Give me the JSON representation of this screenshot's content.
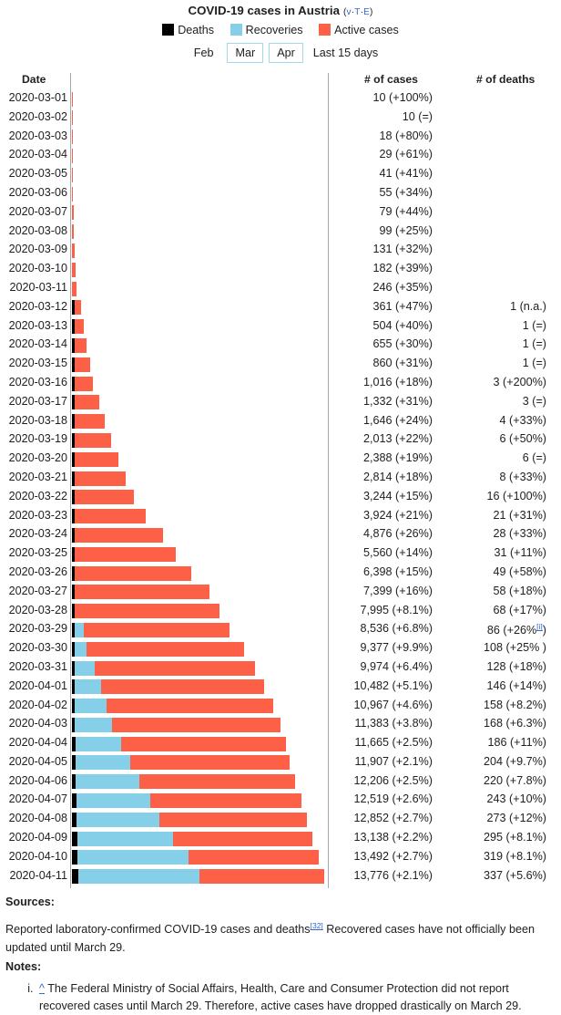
{
  "header": {
    "title": "COVID-19 cases in Austria",
    "vte": {
      "open": "(",
      "v": "v",
      "sep1": "·",
      "t": "T",
      "sep2": "·",
      "e": "E",
      "close": ")"
    },
    "legend": [
      {
        "label": "Deaths",
        "color": "#000000",
        "icon": "legend-swatch"
      },
      {
        "label": "Recoveries",
        "color": "#85cfe8",
        "icon": "legend-swatch"
      },
      {
        "label": "Active cases",
        "color": "#fc6148",
        "icon": "legend-swatch"
      }
    ],
    "months": [
      {
        "label": "Feb",
        "boxed": false
      },
      {
        "label": "Mar",
        "boxed": true
      },
      {
        "label": "Apr",
        "boxed": true
      }
    ],
    "range_label": "Last 15 days"
  },
  "table": {
    "columns": {
      "date": "Date",
      "cases": "# of cases",
      "deaths": "# of deaths"
    }
  },
  "chart_data": {
    "type": "bar",
    "title": "COVID-19 cases in Austria",
    "orientation": "horizontal",
    "stacked": true,
    "xlabel": "",
    "ylabel": "Date",
    "xlim": [
      0,
      13776
    ],
    "grid": false,
    "legend_position": "top",
    "series": [
      {
        "name": "Deaths",
        "color": "#000000"
      },
      {
        "name": "Recoveries",
        "color": "#85cfe8"
      },
      {
        "name": "Active cases",
        "color": "#fc6148"
      }
    ],
    "categories": [
      "2020-03-01",
      "2020-03-02",
      "2020-03-03",
      "2020-03-04",
      "2020-03-05",
      "2020-03-06",
      "2020-03-07",
      "2020-03-08",
      "2020-03-09",
      "2020-03-10",
      "2020-03-11",
      "2020-03-12",
      "2020-03-13",
      "2020-03-14",
      "2020-03-15",
      "2020-03-16",
      "2020-03-17",
      "2020-03-18",
      "2020-03-19",
      "2020-03-20",
      "2020-03-21",
      "2020-03-22",
      "2020-03-23",
      "2020-03-24",
      "2020-03-25",
      "2020-03-26",
      "2020-03-27",
      "2020-03-28",
      "2020-03-29",
      "2020-03-30",
      "2020-03-31",
      "2020-04-01",
      "2020-04-02",
      "2020-04-03",
      "2020-04-04",
      "2020-04-05",
      "2020-04-06",
      "2020-04-07",
      "2020-04-08",
      "2020-04-09",
      "2020-04-10",
      "2020-04-11"
    ],
    "rows": [
      {
        "date": "2020-03-01",
        "cases": 10,
        "cases_label": "10 (+100%)",
        "deaths": 0,
        "deaths_label": "",
        "deaths_sup": "",
        "recoveries": 0
      },
      {
        "date": "2020-03-02",
        "cases": 10,
        "cases_label": "10 (=)",
        "deaths": 0,
        "deaths_label": "",
        "deaths_sup": "",
        "recoveries": 0
      },
      {
        "date": "2020-03-03",
        "cases": 18,
        "cases_label": "18 (+80%)",
        "deaths": 0,
        "deaths_label": "",
        "deaths_sup": "",
        "recoveries": 0
      },
      {
        "date": "2020-03-04",
        "cases": 29,
        "cases_label": "29 (+61%)",
        "deaths": 0,
        "deaths_label": "",
        "deaths_sup": "",
        "recoveries": 0
      },
      {
        "date": "2020-03-05",
        "cases": 41,
        "cases_label": "41 (+41%)",
        "deaths": 0,
        "deaths_label": "",
        "deaths_sup": "",
        "recoveries": 0
      },
      {
        "date": "2020-03-06",
        "cases": 55,
        "cases_label": "55 (+34%)",
        "deaths": 0,
        "deaths_label": "",
        "deaths_sup": "",
        "recoveries": 0
      },
      {
        "date": "2020-03-07",
        "cases": 79,
        "cases_label": "79 (+44%)",
        "deaths": 0,
        "deaths_label": "",
        "deaths_sup": "",
        "recoveries": 0
      },
      {
        "date": "2020-03-08",
        "cases": 99,
        "cases_label": "99 (+25%)",
        "deaths": 0,
        "deaths_label": "",
        "deaths_sup": "",
        "recoveries": 0
      },
      {
        "date": "2020-03-09",
        "cases": 131,
        "cases_label": "131 (+32%)",
        "deaths": 0,
        "deaths_label": "",
        "deaths_sup": "",
        "recoveries": 0
      },
      {
        "date": "2020-03-10",
        "cases": 182,
        "cases_label": "182 (+39%)",
        "deaths": 0,
        "deaths_label": "",
        "deaths_sup": "",
        "recoveries": 0
      },
      {
        "date": "2020-03-11",
        "cases": 246,
        "cases_label": "246 (+35%)",
        "deaths": 0,
        "deaths_label": "",
        "deaths_sup": "",
        "recoveries": 0
      },
      {
        "date": "2020-03-12",
        "cases": 361,
        "cases_label": "361 (+47%)",
        "deaths": 1,
        "deaths_label": "1 (n.a.)",
        "deaths_sup": "",
        "recoveries": 0
      },
      {
        "date": "2020-03-13",
        "cases": 504,
        "cases_label": "504 (+40%)",
        "deaths": 1,
        "deaths_label": "1 (=)",
        "deaths_sup": "",
        "recoveries": 0
      },
      {
        "date": "2020-03-14",
        "cases": 655,
        "cases_label": "655 (+30%)",
        "deaths": 1,
        "deaths_label": "1 (=)",
        "deaths_sup": "",
        "recoveries": 0
      },
      {
        "date": "2020-03-15",
        "cases": 860,
        "cases_label": "860 (+31%)",
        "deaths": 1,
        "deaths_label": "1 (=)",
        "deaths_sup": "",
        "recoveries": 0
      },
      {
        "date": "2020-03-16",
        "cases": 1016,
        "cases_label": "1,016 (+18%)",
        "deaths": 3,
        "deaths_label": "3 (+200%)",
        "deaths_sup": "",
        "recoveries": 0
      },
      {
        "date": "2020-03-17",
        "cases": 1332,
        "cases_label": "1,332 (+31%)",
        "deaths": 3,
        "deaths_label": "3 (=)",
        "deaths_sup": "",
        "recoveries": 0
      },
      {
        "date": "2020-03-18",
        "cases": 1646,
        "cases_label": "1,646 (+24%)",
        "deaths": 4,
        "deaths_label": "4 (+33%)",
        "deaths_sup": "",
        "recoveries": 0
      },
      {
        "date": "2020-03-19",
        "cases": 2013,
        "cases_label": "2,013 (+22%)",
        "deaths": 6,
        "deaths_label": "6 (+50%)",
        "deaths_sup": "",
        "recoveries": 0
      },
      {
        "date": "2020-03-20",
        "cases": 2388,
        "cases_label": "2,388 (+19%)",
        "deaths": 6,
        "deaths_label": "6 (=)",
        "deaths_sup": "",
        "recoveries": 0
      },
      {
        "date": "2020-03-21",
        "cases": 2814,
        "cases_label": "2,814 (+18%)",
        "deaths": 8,
        "deaths_label": "8 (+33%)",
        "deaths_sup": "",
        "recoveries": 0
      },
      {
        "date": "2020-03-22",
        "cases": 3244,
        "cases_label": "3,244 (+15%)",
        "deaths": 16,
        "deaths_label": "16 (+100%)",
        "deaths_sup": "",
        "recoveries": 0
      },
      {
        "date": "2020-03-23",
        "cases": 3924,
        "cases_label": "3,924 (+21%)",
        "deaths": 21,
        "deaths_label": "21 (+31%)",
        "deaths_sup": "",
        "recoveries": 0
      },
      {
        "date": "2020-03-24",
        "cases": 4876,
        "cases_label": "4,876 (+26%)",
        "deaths": 28,
        "deaths_label": "28 (+33%)",
        "deaths_sup": "",
        "recoveries": 0
      },
      {
        "date": "2020-03-25",
        "cases": 5560,
        "cases_label": "5,560 (+14%)",
        "deaths": 31,
        "deaths_label": "31 (+11%)",
        "deaths_sup": "",
        "recoveries": 0
      },
      {
        "date": "2020-03-26",
        "cases": 6398,
        "cases_label": "6,398 (+15%)",
        "deaths": 49,
        "deaths_label": "49 (+58%)",
        "deaths_sup": "",
        "recoveries": 0
      },
      {
        "date": "2020-03-27",
        "cases": 7399,
        "cases_label": "7,399 (+16%)",
        "deaths": 58,
        "deaths_label": "58 (+18%)",
        "deaths_sup": "",
        "recoveries": 0
      },
      {
        "date": "2020-03-28",
        "cases": 7995,
        "cases_label": "7,995 (+8.1%)",
        "deaths": 68,
        "deaths_label": "68 (+17%)",
        "deaths_sup": "",
        "recoveries": 0
      },
      {
        "date": "2020-03-29",
        "cases": 8536,
        "cases_label": "8,536 (+6.8%)",
        "deaths": 86,
        "deaths_label": "86 (+26%",
        "deaths_sup": "[i]",
        "deaths_suffix": ")",
        "recoveries": 479
      },
      {
        "date": "2020-03-30",
        "cases": 9377,
        "cases_label": "9,377 (+9.9%)",
        "deaths": 108,
        "deaths_label": "108 (+25% )",
        "deaths_sup": "",
        "recoveries": 636
      },
      {
        "date": "2020-03-31",
        "cases": 9974,
        "cases_label": "9,974 (+6.4%)",
        "deaths": 128,
        "deaths_label": "128 (+18%)",
        "deaths_sup": "",
        "recoveries": 1095
      },
      {
        "date": "2020-04-01",
        "cases": 10482,
        "cases_label": "10,482 (+5.1%)",
        "deaths": 146,
        "deaths_label": "146 (+14%)",
        "deaths_sup": "",
        "recoveries": 1436
      },
      {
        "date": "2020-04-02",
        "cases": 10967,
        "cases_label": "10,967 (+4.6%)",
        "deaths": 158,
        "deaths_label": "158 (+8.2%)",
        "deaths_sup": "",
        "recoveries": 1749
      },
      {
        "date": "2020-04-03",
        "cases": 11383,
        "cases_label": "11,383 (+3.8%)",
        "deaths": 168,
        "deaths_label": "168 (+6.3%)",
        "deaths_sup": "",
        "recoveries": 2022
      },
      {
        "date": "2020-04-04",
        "cases": 11665,
        "cases_label": "11,665 (+2.5%)",
        "deaths": 186,
        "deaths_label": "186 (+11%)",
        "deaths_sup": "",
        "recoveries": 2507
      },
      {
        "date": "2020-04-05",
        "cases": 11907,
        "cases_label": "11,907 (+2.1%)",
        "deaths": 204,
        "deaths_label": "204 (+9.7%)",
        "deaths_sup": "",
        "recoveries": 2998
      },
      {
        "date": "2020-04-06",
        "cases": 12206,
        "cases_label": "12,206 (+2.5%)",
        "deaths": 220,
        "deaths_label": "220 (+7.8%)",
        "deaths_sup": "",
        "recoveries": 3463
      },
      {
        "date": "2020-04-07",
        "cases": 12519,
        "cases_label": "12,519 (+2.6%)",
        "deaths": 243,
        "deaths_label": "243 (+10%)",
        "deaths_sup": "",
        "recoveries": 4046
      },
      {
        "date": "2020-04-08",
        "cases": 12852,
        "cases_label": "12,852 (+2.7%)",
        "deaths": 273,
        "deaths_label": "273 (+12%)",
        "deaths_sup": "",
        "recoveries": 4512
      },
      {
        "date": "2020-04-09",
        "cases": 13138,
        "cases_label": "13,138 (+2.2%)",
        "deaths": 295,
        "deaths_label": "295 (+8.1%)",
        "deaths_sup": "",
        "recoveries": 5240
      },
      {
        "date": "2020-04-10",
        "cases": 13492,
        "cases_label": "13,492 (+2.7%)",
        "deaths": 319,
        "deaths_label": "319 (+8.1%)",
        "deaths_sup": "",
        "recoveries": 6064
      },
      {
        "date": "2020-04-11",
        "cases": 13776,
        "cases_label": "13,776 (+2.1%)",
        "deaths": 337,
        "deaths_label": "337 (+5.6%)",
        "deaths_sup": "",
        "recoveries": 6604
      }
    ]
  },
  "footer": {
    "sources_label": "Sources:",
    "sources_text_1": "Reported laboratory-confirmed COVID-19 cases and deaths",
    "sources_ref": "[32]",
    "sources_text_2": " Recovered cases have not officially been updated until March 29.",
    "notes_label": "Notes:",
    "notes": [
      {
        "caret": "^",
        "text": "The Federal Ministry of Social Affairs, Health, Care and Consumer Protection did not report recovered cases until March 29. Therefore, active cases have dropped drastically on March 29."
      }
    ]
  }
}
